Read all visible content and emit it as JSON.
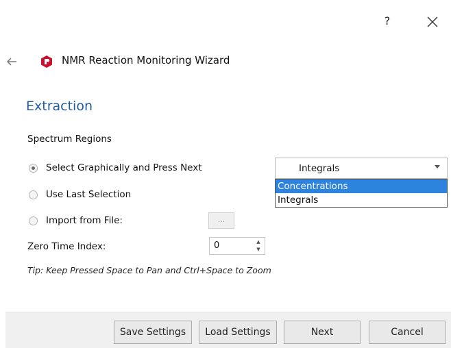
{
  "titlebar": {
    "help_label": "?"
  },
  "header": {
    "title": "NMR Reaction Monitoring Wizard"
  },
  "page": {
    "section_title": "Extraction",
    "group_label": "Spectrum Regions",
    "options": [
      {
        "label": "Select Graphically and Press Next",
        "checked": true
      },
      {
        "label": "Use Last Selection",
        "checked": false
      },
      {
        "label": "Import from File:",
        "checked": false
      }
    ],
    "browse_label": "...",
    "zero_time_label": "Zero Time Index:",
    "zero_time_value": "0",
    "tip": "Tip: Keep Pressed Space to Pan and Ctrl+Space to Zoom"
  },
  "combo": {
    "selected_value": "Integrals",
    "options": [
      "Concentrations",
      "Integrals"
    ],
    "highlighted": "Concentrations"
  },
  "footer": {
    "save_label": "Save Settings",
    "load_label": "Load Settings",
    "next_label": "Next",
    "cancel_label": "Cancel"
  },
  "colors": {
    "accent": "#1f5c99",
    "logo": "#c8102e",
    "highlight": "#2e84dd"
  }
}
